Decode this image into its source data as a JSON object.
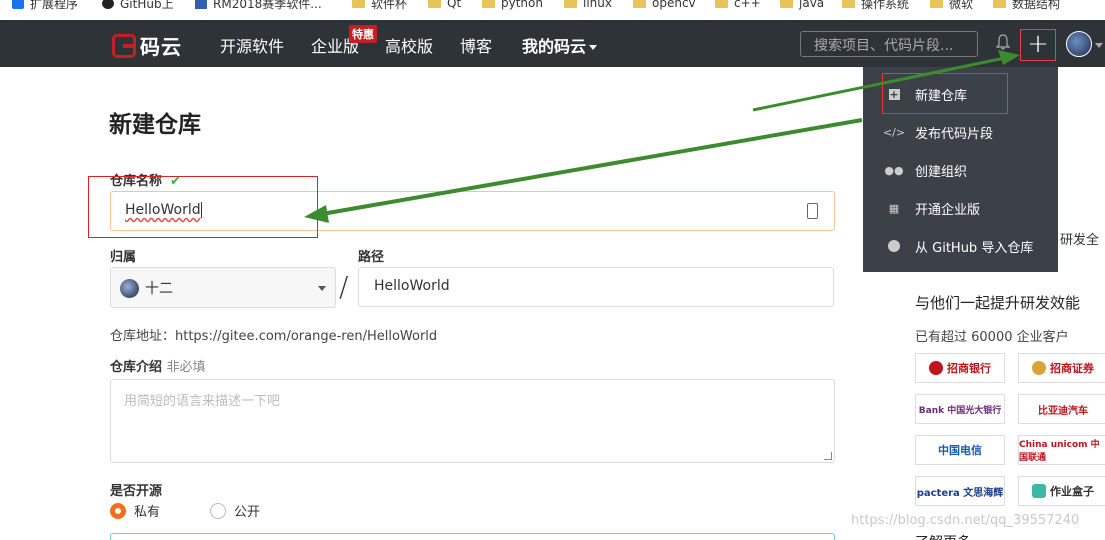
{
  "bookmarks": [
    "扩展程序",
    "GitHub上",
    "RM2018赛季软件...",
    "软件杯",
    "Qt",
    "python",
    "linux",
    "opencv",
    "c++",
    "java",
    "操作系统",
    "微软",
    "数据结构"
  ],
  "nav": {
    "logo_text": "码云",
    "items": [
      "开源软件",
      "企业版",
      "高校版",
      "博客",
      "我的码云"
    ],
    "badge": "特惠",
    "search_placeholder": "搜索项目、代码片段...",
    "plus": "+"
  },
  "dropdown": {
    "items": [
      "新建仓库",
      "发布代码片段",
      "创建组织",
      "开通企业版",
      "从 GitHub 导入仓库"
    ]
  },
  "form": {
    "title": "新建仓库",
    "repo_name_label": "仓库名称",
    "repo_name_value": "HelloWorld",
    "owner_label": "归属",
    "owner_value": "十二",
    "path_label": "路径",
    "path_value": "HelloWorld",
    "slash": "/",
    "address": "仓库地址：https://gitee.com/orange-ren/HelloWorld",
    "intro_label": "仓库介绍",
    "intro_optional": "非必填",
    "intro_placeholder": "用简短的语言来描述一下吧",
    "open_label": "是否开源",
    "private": "私有",
    "public": "公开"
  },
  "side": {
    "truncated": "研发全",
    "heading": "与他们一起提升研发效能",
    "sub": "已有超过 60000 企业客户",
    "logos": [
      "招商银行",
      "招商证券",
      "Bank 中国光大银行",
      "比亚迪汽车",
      "中国电信",
      "China unicom 中国联通",
      "pactera 文思海辉",
      "作业盒子"
    ],
    "bottom": "了解更多"
  },
  "watermark": "https://blog.csdn.net/qq_39557240",
  "colors": {
    "nav_bg": "#2e3338",
    "brand_red": "#c71d23",
    "arrow_green": "#3d8b2f",
    "radio_orange": "#f46f19"
  }
}
